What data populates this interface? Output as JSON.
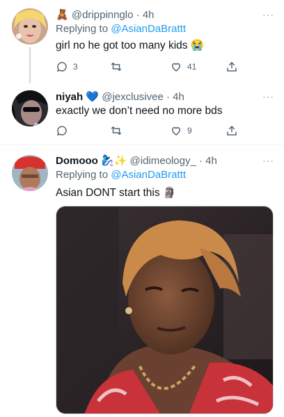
{
  "tweets": [
    {
      "author_emoji": "🧸",
      "handle": "@drippinnglo",
      "time": "· 4h",
      "replying_prefix": "Replying to",
      "replying_to": "@AsianDaBrattt",
      "text": "girl no he got too many kids",
      "text_emoji": "😭",
      "replies": "3",
      "retweets": "",
      "likes": "41"
    },
    {
      "name": "niyah",
      "name_emoji": "💙",
      "handle": "@jexclusivee",
      "time": "· 4h",
      "text": "exactly we don’t need no more bds",
      "replies": "",
      "retweets": "",
      "likes": "9"
    },
    {
      "name": "Domooo",
      "name_emoji": "🧞‍♀️✨",
      "handle": "@idimeology_",
      "time": "· 4h",
      "replying_prefix": "Replying to",
      "replying_to": "@AsianDaBrattt",
      "text": "Asian DONT start this",
      "text_emoji": "🗿"
    }
  ],
  "more_label": "···",
  "colors": {
    "accent": "#1d9bf0",
    "secondary_text": "#536471",
    "verified_heart": "#1d7cf0"
  }
}
